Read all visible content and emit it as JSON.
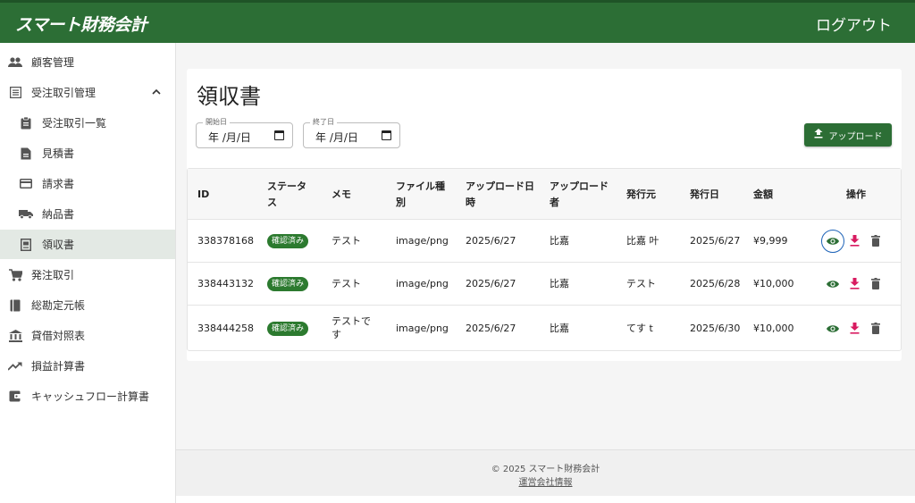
{
  "app": {
    "logo": "スマート財務会計",
    "logout": "ログアウト"
  },
  "sidebar": {
    "items": [
      {
        "label": "顧客管理",
        "icon": "people-icon"
      },
      {
        "label": "受注取引管理",
        "icon": "list-icon",
        "expanded": true
      },
      {
        "label": "受注取引一覧",
        "icon": "clipboard-icon"
      },
      {
        "label": "見積書",
        "icon": "document-icon"
      },
      {
        "label": "請求書",
        "icon": "credit-card-icon"
      },
      {
        "label": "納品書",
        "icon": "truck-icon"
      },
      {
        "label": "領収書",
        "icon": "receipt-icon",
        "active": true
      },
      {
        "label": "発注取引",
        "icon": "cart-icon"
      },
      {
        "label": "総勘定元帳",
        "icon": "book-icon"
      },
      {
        "label": "貸借対照表",
        "icon": "bank-icon"
      },
      {
        "label": "損益計算書",
        "icon": "trending-up-icon"
      },
      {
        "label": "キャッシュフロー計算書",
        "icon": "wallet-icon"
      }
    ]
  },
  "page": {
    "title": "領収書",
    "start_date": {
      "label": "開始日",
      "value": "年 /月/日"
    },
    "end_date": {
      "label": "終了日",
      "value": "年 /月/日"
    },
    "upload_button": "アップロード"
  },
  "table": {
    "headers": {
      "id": "ID",
      "status_1": "ステータ",
      "status_2": "ス",
      "memo": "メモ",
      "filetype_1": "ファイル種",
      "filetype_2": "別",
      "date_1": "アップロード日",
      "date_2": "時",
      "uploader_1": "アップロード",
      "uploader_2": "者",
      "issuer": "発行元",
      "issue_date": "発行日",
      "amount": "金額",
      "actions": "操作"
    },
    "rows": [
      {
        "id": "338378168",
        "status": "確認済み",
        "memo_1": "テスト",
        "memo_2": "",
        "filetype": "image/png",
        "uploaded": "2025/6/27",
        "uploader": "比嘉",
        "issuer": "比嘉 叶",
        "issue_date": "2025/6/27",
        "amount": "¥9,999"
      },
      {
        "id": "338443132",
        "status": "確認済み",
        "memo_1": "テスト",
        "memo_2": "",
        "filetype": "image/png",
        "uploaded": "2025/6/27",
        "uploader": "比嘉",
        "issuer": "テスト",
        "issue_date": "2025/6/28",
        "amount": "¥10,000"
      },
      {
        "id": "338444258",
        "status": "確認済み",
        "memo_1": "テストで",
        "memo_2": "す",
        "filetype": "image/png",
        "uploaded": "2025/6/27",
        "uploader": "比嘉",
        "issuer": "てす t",
        "issue_date": "2025/6/30",
        "amount": "¥10,000"
      }
    ]
  },
  "footer": {
    "copyright": "© 2025 スマート財務会計",
    "company_link": "運営会社情報"
  },
  "colors": {
    "primary": "#2c6e35",
    "badge": "#2c7a2f",
    "download": "#d81b60",
    "focus_ring": "#1e63b8"
  }
}
